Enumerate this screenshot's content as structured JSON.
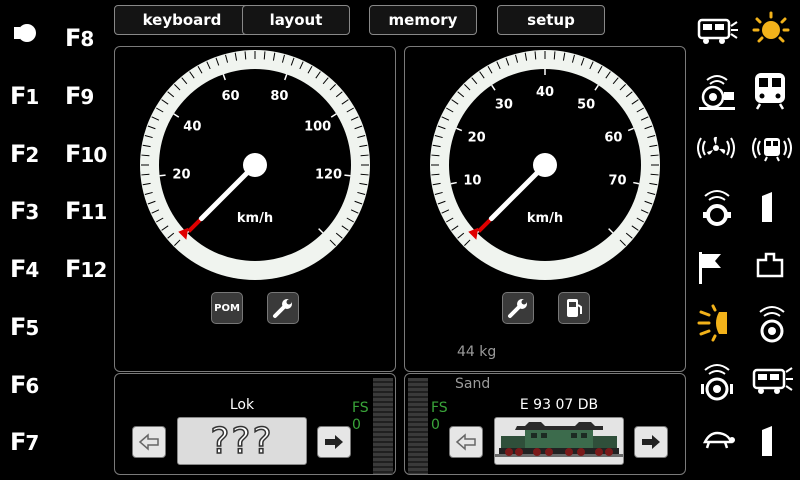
{
  "toolbar": {
    "keyboard_label": "keyboard",
    "layout_label": "layout",
    "memory_label": "memory",
    "setup_label": "setup"
  },
  "function_keys": {
    "left": [
      {
        "prefix": "F",
        "num": "1"
      },
      {
        "prefix": "F",
        "num": "2"
      },
      {
        "prefix": "F",
        "num": "3"
      },
      {
        "prefix": "F",
        "num": "4"
      },
      {
        "prefix": "F",
        "num": "5"
      },
      {
        "prefix": "F",
        "num": "6"
      },
      {
        "prefix": "F",
        "num": "7"
      }
    ],
    "right": [
      {
        "prefix": "F",
        "num": "8"
      },
      {
        "prefix": "F",
        "num": "9"
      },
      {
        "prefix": "F",
        "num": "10"
      },
      {
        "prefix": "F",
        "num": "11"
      },
      {
        "prefix": "F",
        "num": "12"
      }
    ]
  },
  "gauge_left": {
    "unit": "km/h",
    "ticks": [
      "20",
      "40",
      "60",
      "80",
      "100",
      "120"
    ],
    "needle_value": 0,
    "pom_label": "POM"
  },
  "gauge_right": {
    "unit": "km/h",
    "ticks": [
      "10",
      "20",
      "30",
      "40",
      "50",
      "60",
      "70"
    ],
    "needle_value": 0,
    "weight": "44 kg"
  },
  "loco_left": {
    "name": "Lok",
    "image_text": "???",
    "fs_label": "FS",
    "fs_value": "0"
  },
  "loco_right": {
    "sand_label": "Sand",
    "name": "E 93 07 DB",
    "fs_label": "FS",
    "fs_value": "0"
  },
  "colors": {
    "background": "#000000",
    "green": "#3aa53a",
    "needle_marker": "#e00000",
    "dial_ring": "#f0f4ef"
  },
  "right_icons": [
    "train-light-icon",
    "sun-light-icon",
    "sound-horn-icon",
    "cab-front-icon",
    "fan-sound-icon",
    "cab-sound-icon",
    "compressor-sound-icon",
    "door-icon",
    "flag-icon",
    "coupler-icon",
    "headlight-icon",
    "bell-sound-icon",
    "brake-sound-icon",
    "shunting-icon",
    "turtle-icon",
    "door-icon-2"
  ]
}
